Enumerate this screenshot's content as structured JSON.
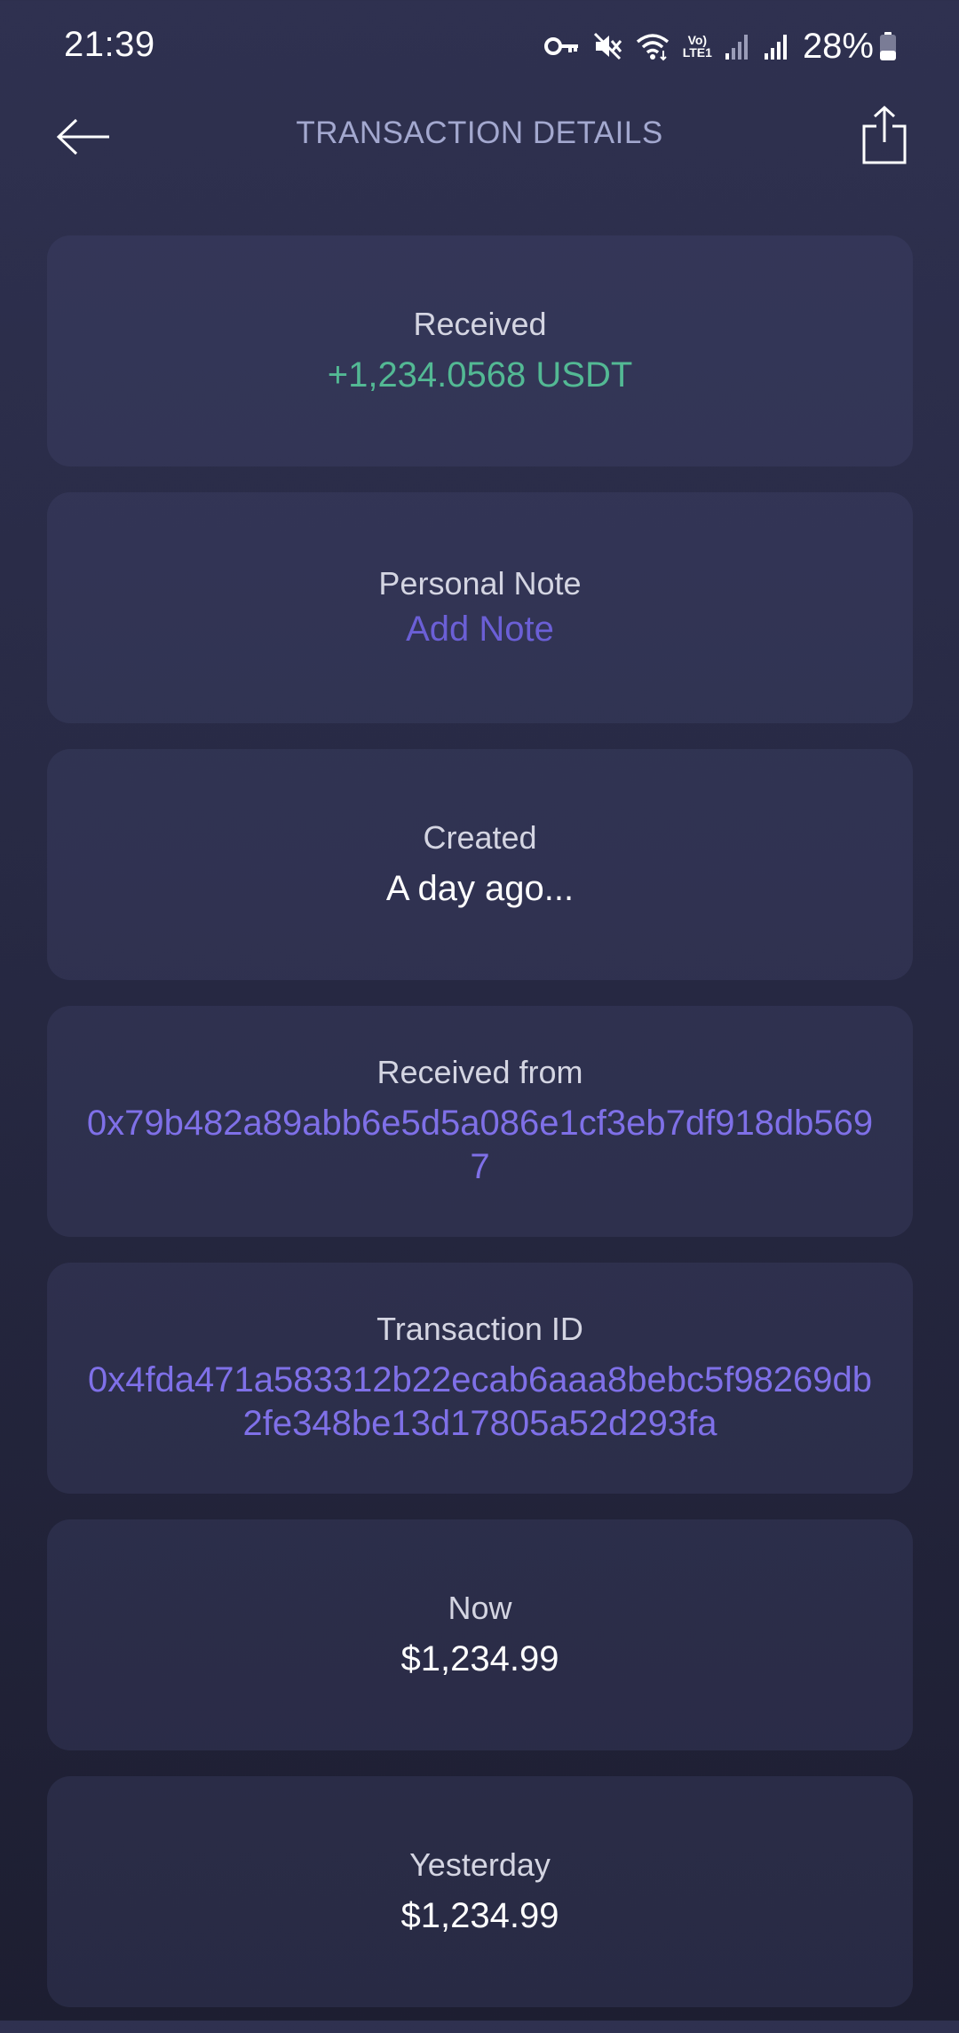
{
  "status_bar": {
    "time": "21:39",
    "battery": "28%",
    "network_label_top": "Vo)",
    "network_label_bottom": "LTE1",
    "icons": [
      "key-icon",
      "mute-icon",
      "wifi-icon",
      "volte-icon",
      "signal-icon",
      "signal-icon",
      "battery-icon"
    ]
  },
  "app_bar": {
    "title": "TRANSACTION DETAILS",
    "back_icon": "arrow-left-icon",
    "share_icon": "share-icon"
  },
  "cards": {
    "received": {
      "label": "Received",
      "value": "+1,234.0568 USDT"
    },
    "note": {
      "label": "Personal Note",
      "value": "Add Note"
    },
    "created": {
      "label": "Created",
      "value": "A day ago..."
    },
    "received_from": {
      "label": "Received from",
      "value": "0x79b482a89abb6e5d5a086e1cf3eb7df918db5697"
    },
    "transaction_id": {
      "label": "Transaction ID",
      "value": "0x4fda471a583312b22ecab6aaa8bebc5f98269db2fe348be13d17805a52d293fa"
    },
    "now": {
      "label": "Now",
      "value": "$1,234.99"
    },
    "yesterday": {
      "label": "Yesterday",
      "value": "$1,234.99"
    }
  },
  "colors": {
    "received_amount": "#53b994",
    "link": "#7f70e8",
    "title": "#a3a8cf"
  }
}
